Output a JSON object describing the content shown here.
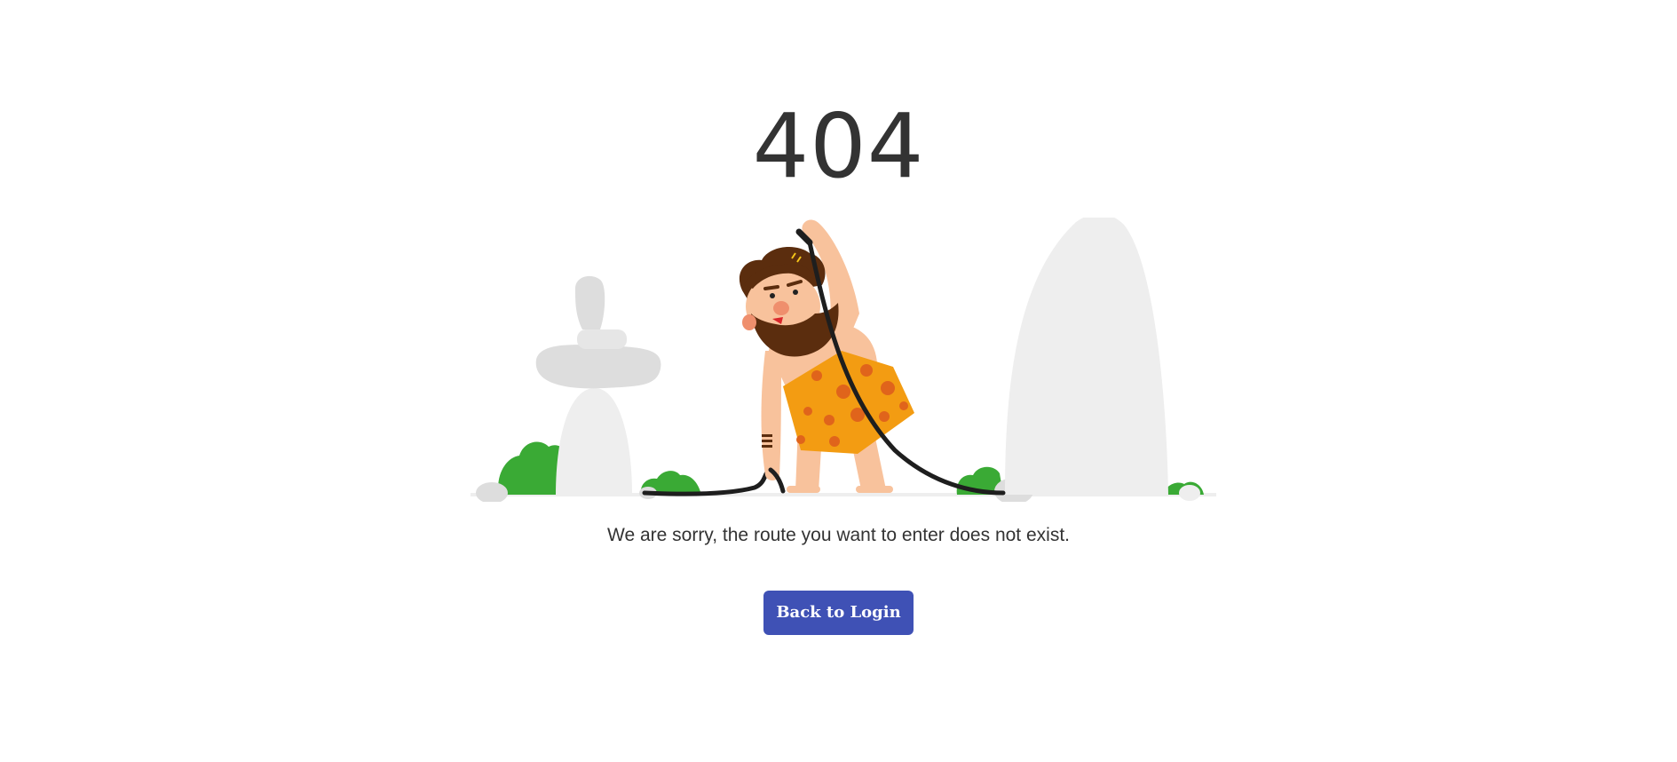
{
  "error": {
    "code": "404",
    "message": "We are sorry, the route you want to enter does not exist."
  },
  "actions": {
    "back_label": "Back to Login"
  },
  "illustration": {
    "subject": "caveman-pulling-cable",
    "colors": {
      "rock": "#eeeeee",
      "rock_dark": "#dddddd",
      "bush": "#3aaa35",
      "skin": "#f8c29c",
      "hair": "#5b2d0e",
      "tunic": "#f39c12",
      "tunic_spots": "#e0641b",
      "cable": "#1e1e1e"
    }
  },
  "theme": {
    "accent": "#3f51b5",
    "text": "#333333",
    "background": "#ffffff"
  }
}
